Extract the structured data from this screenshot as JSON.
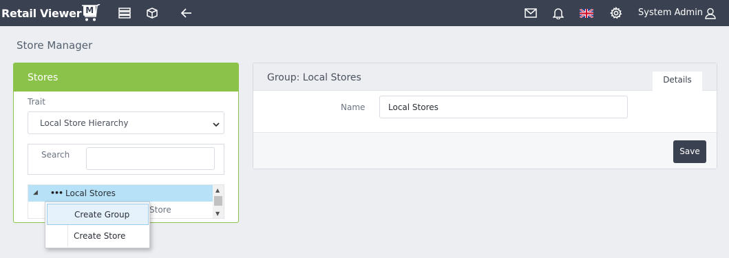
{
  "app": {
    "logo_text": "Retail Viewer",
    "logo_badge": "M"
  },
  "topbar": {
    "user_name": "System Admin"
  },
  "page": {
    "title": "Store Manager"
  },
  "stores": {
    "header": "Stores",
    "trait_label": "Trait",
    "trait_value": "Local Store Hierarchy",
    "search_label": "Search",
    "search_value": "",
    "tree": {
      "selected_label": "Local Stores",
      "second_row_fragment": "Store"
    }
  },
  "context_menu": {
    "items": [
      "Create Group",
      "Create Store"
    ]
  },
  "group": {
    "title": "Group: Local Stores",
    "tab_details": "Details",
    "name_label": "Name",
    "name_value": "Local Stores",
    "save_label": "Save"
  },
  "colors": {
    "topbar": "#3a4150",
    "accent_green": "#8bc34a",
    "selection": "#b6e1f7"
  }
}
